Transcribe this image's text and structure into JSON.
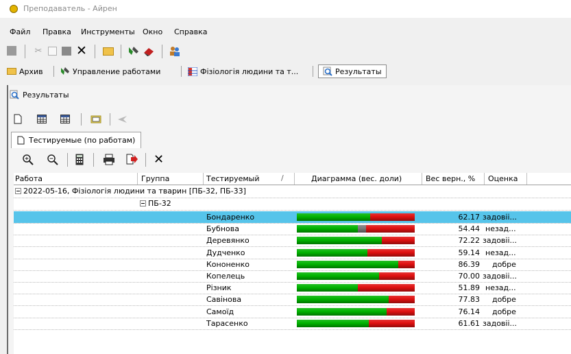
{
  "window": {
    "title": "Преподаватель - Айрен"
  },
  "menu": [
    "Файл",
    "Правка",
    "Инструменты",
    "Окно",
    "Справка"
  ],
  "tabs": [
    {
      "label": "Архив",
      "icon": "folder-icon"
    },
    {
      "label": "Управление работами",
      "icon": "tools-icon"
    },
    {
      "label": "Фізіологія людини та т...",
      "icon": "table-icon"
    },
    {
      "label": "Результаты",
      "icon": "magnifier-icon"
    }
  ],
  "panel": {
    "title": "Результаты"
  },
  "subtab": {
    "label": "Тестируемые (по работам)"
  },
  "columns": [
    "Работа",
    "Группа",
    "Тестируемый",
    "Диаграмма (вес. доли)",
    "Вес верн., %",
    "Оценка"
  ],
  "group": {
    "work": "2022-05-16, Фізіологія людини та тварин [ПБ-32, ПБ-33]",
    "group": "ПБ-32"
  },
  "colors": {
    "correct": "#00b300",
    "wrong": "#e01010",
    "partial": "#7a7a7a",
    "selection": "#56c4ea"
  },
  "rows": [
    {
      "name": "Бондаренко",
      "pct": "62.17",
      "grade": "задовіі...",
      "bar": [
        0.62,
        0.0,
        0.38
      ],
      "selected": true
    },
    {
      "name": "Бубнова",
      "pct": "54.44",
      "grade": "незад...",
      "bar": [
        0.52,
        0.07,
        0.41
      ]
    },
    {
      "name": "Деревянко",
      "pct": "72.22",
      "grade": "задовіі...",
      "bar": [
        0.72,
        0.0,
        0.28
      ]
    },
    {
      "name": "Дудченко",
      "pct": "59.14",
      "grade": "незад...",
      "bar": [
        0.6,
        0.0,
        0.4
      ]
    },
    {
      "name": "Кононенко",
      "pct": "86.39",
      "grade": "добре",
      "bar": [
        0.86,
        0.0,
        0.14
      ]
    },
    {
      "name": "Копелець",
      "pct": "70.00",
      "grade": "задовіі...",
      "bar": [
        0.7,
        0.0,
        0.3
      ]
    },
    {
      "name": "Різник",
      "pct": "51.89",
      "grade": "незад...",
      "bar": [
        0.52,
        0.0,
        0.48
      ]
    },
    {
      "name": "Савінова",
      "pct": "77.83",
      "grade": "добре",
      "bar": [
        0.78,
        0.0,
        0.22
      ]
    },
    {
      "name": "Самоїд",
      "pct": "76.14",
      "grade": "добре",
      "bar": [
        0.76,
        0.0,
        0.24
      ]
    },
    {
      "name": "Тарасенко",
      "pct": "61.61",
      "grade": "задовіі...",
      "bar": [
        0.61,
        0.0,
        0.39
      ]
    }
  ]
}
